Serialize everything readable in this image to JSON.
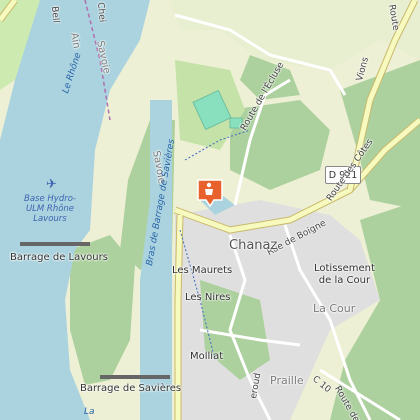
{
  "map": {
    "labels": {
      "rhone": "Le Rhône",
      "savoie_1": "Savoie",
      "savoie_2": "Savoie",
      "ain": "Ain",
      "belley": "Bell",
      "cheig": "Chei",
      "bras_barrage": "Bras de Barrage de Savières",
      "route_ecluse": "Route de l'Écluse",
      "vions": "Vions",
      "route_vions": "Route",
      "route_cotes": "Route des Côtes",
      "rue_boigne": "Rue de Boigne",
      "chanaz": "Chanaz",
      "base_hydro": [
        "Base Hydro-",
        "ULM Rhône",
        "Lavours"
      ],
      "barrage_lavours": "Barrage de Lavours",
      "les_maurets": "Les Maurets",
      "les_nires": "Les Nires",
      "lotissement": [
        "Lotissement",
        "de la Cour"
      ],
      "la_cour": "La Cour",
      "molliat": "Molliat",
      "praille": "Praille",
      "barrage_savieres": "Barrage de Savières",
      "c10": "C 10",
      "route_bottom": "Route des",
      "reroud": "eroud",
      "water_bottom": "La"
    },
    "road_shield": "D 921",
    "marker": {
      "icon": "camera-icon",
      "color": "#e8612c"
    },
    "airfield_icon": "plane-icon",
    "colors": {
      "river": "#aad3df",
      "forest": "#add19e",
      "meadow": "#cdebb0",
      "farmland": "#eef0d5",
      "residential": "#e0dfdf",
      "pitch": "#88e0be",
      "road_yellow": "#f7fabf",
      "road_outline": "#c9b96b"
    }
  }
}
